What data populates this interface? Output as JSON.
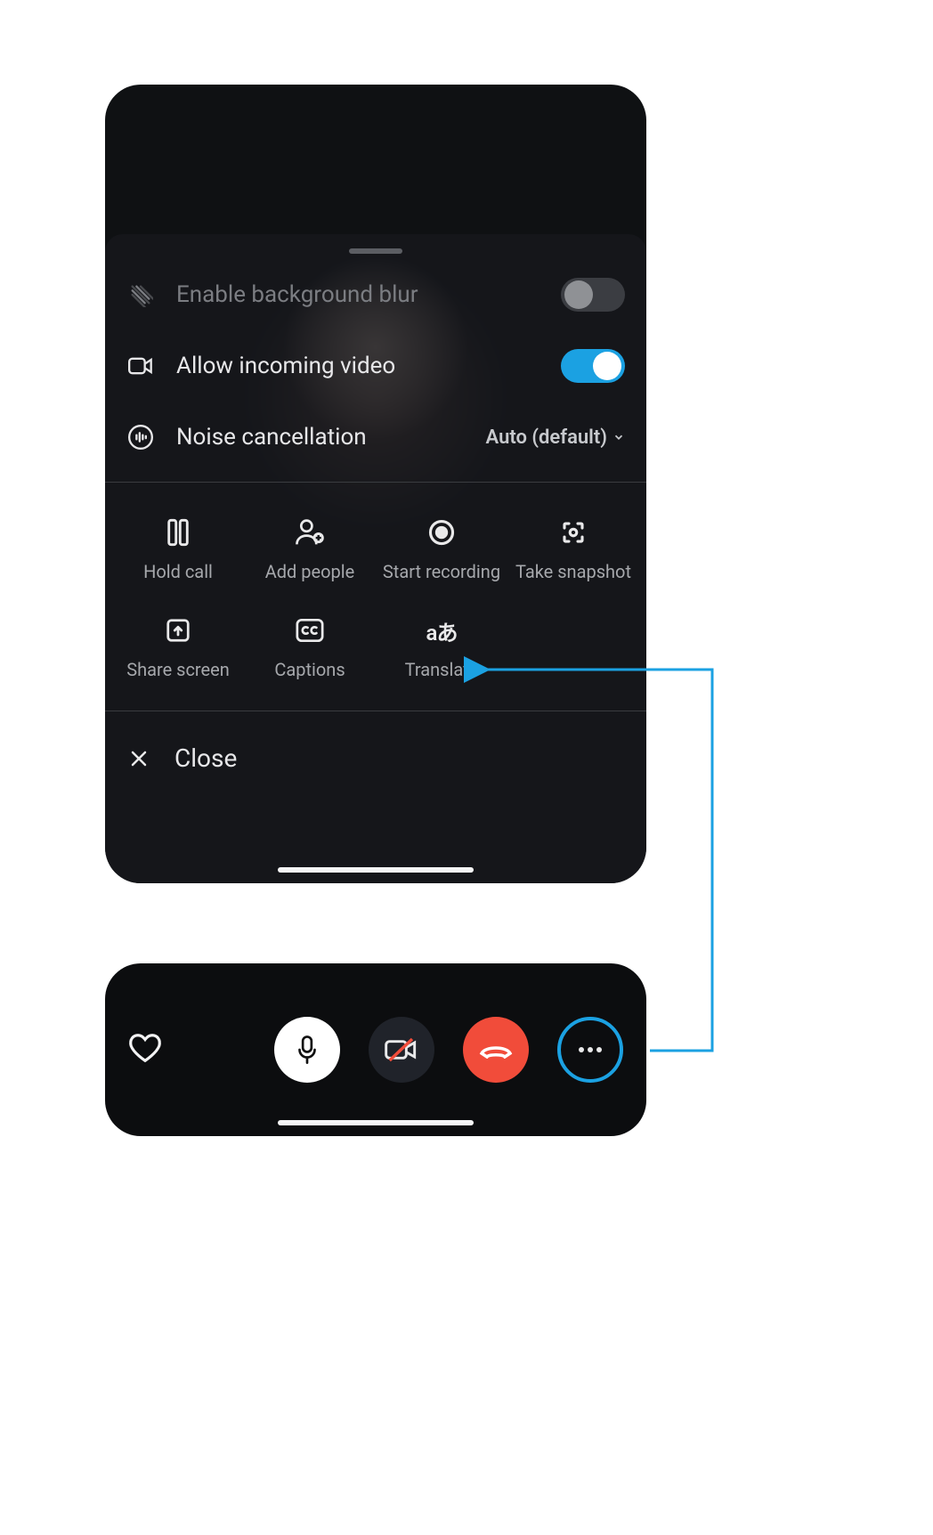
{
  "sheet": {
    "blur_label": "Enable background blur",
    "incoming_label": "Allow incoming video",
    "noise_label": "Noise cancellation",
    "noise_value": "Auto (default)",
    "close_label": "Close"
  },
  "actions": [
    {
      "label": "Hold call"
    },
    {
      "label": "Add people"
    },
    {
      "label": "Start recording"
    },
    {
      "label": "Take snapshot"
    },
    {
      "label": "Share screen"
    },
    {
      "label": "Captions"
    },
    {
      "label": "Translate"
    }
  ],
  "toggles": {
    "blur": false,
    "incoming": true
  }
}
